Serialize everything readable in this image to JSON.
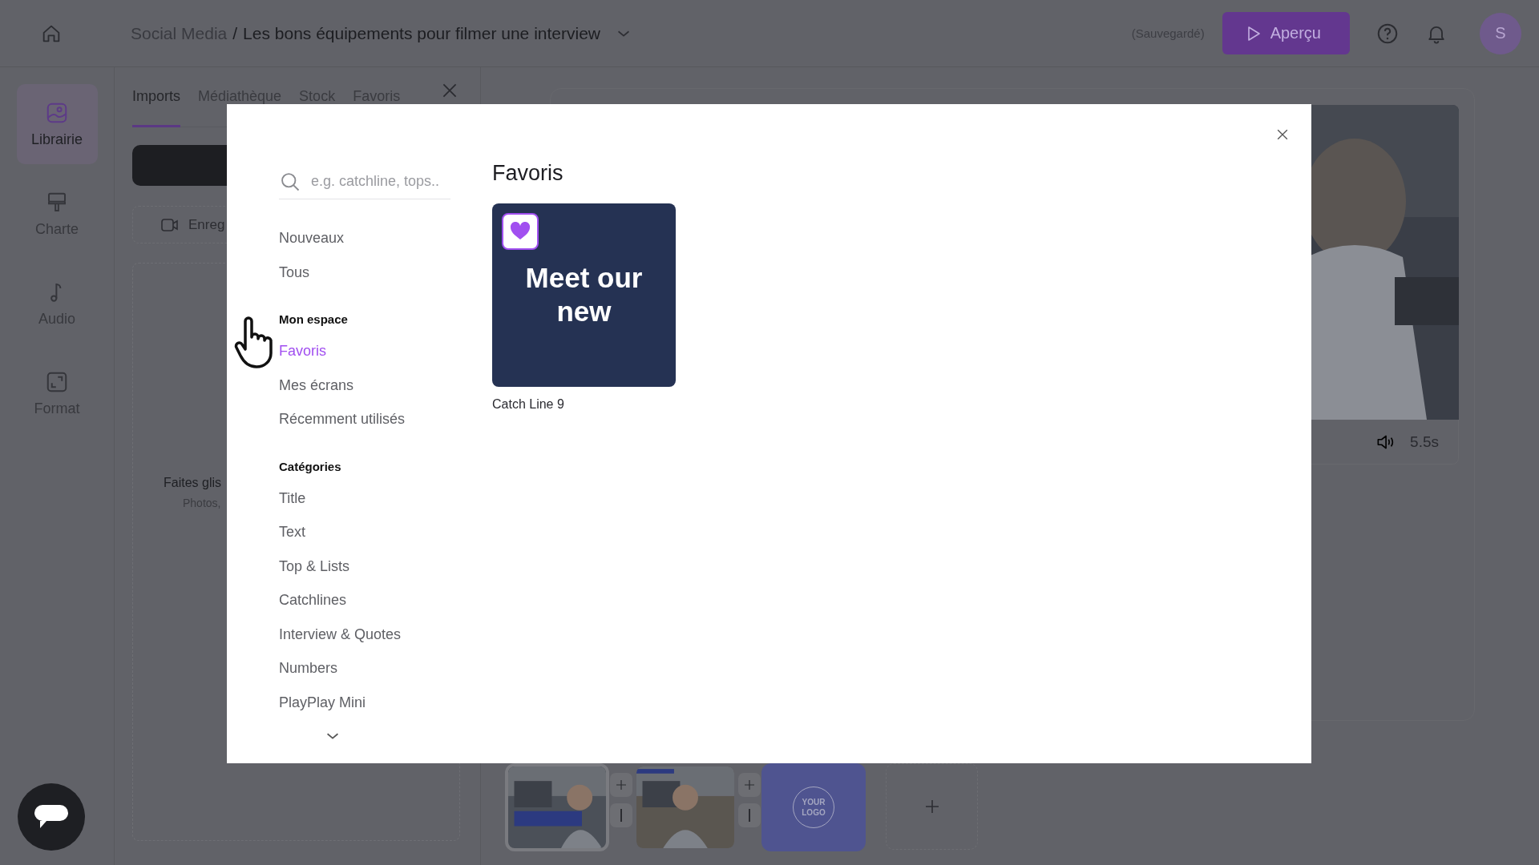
{
  "topbar": {
    "breadcrumb": "Social Media",
    "separator": "/",
    "title": "Les bons équipements pour filmer une interview",
    "save_status": "(Sauvegardé)",
    "preview_button": "Aperçu",
    "avatar": "S"
  },
  "rail": [
    {
      "label": "Librairie",
      "kind": "library",
      "selected": true
    },
    {
      "label": "Charte",
      "kind": "brand",
      "selected": false
    },
    {
      "label": "Audio",
      "kind": "audio",
      "selected": false
    },
    {
      "label": "Format",
      "kind": "format",
      "selected": false
    }
  ],
  "panel": {
    "tabs": [
      {
        "label": "Imports",
        "selected": true
      },
      {
        "label": "Médiathèque",
        "selected": false
      },
      {
        "label": "Stock",
        "selected": false
      },
      {
        "label": "Favoris",
        "selected": false
      }
    ],
    "record_button": "Enreg",
    "drop_title": "Faites glis",
    "drop_hint": "Photos,"
  },
  "preview": {
    "duration": "5.5s"
  },
  "timeline": {
    "slides": [
      {
        "kind": "picture",
        "selected": true
      },
      {
        "kind": "picture",
        "selected": false
      },
      {
        "kind": "logo",
        "text": "YOUR LOGO",
        "selected": false
      }
    ]
  },
  "modal": {
    "search": {
      "placeholder": "e.g. catchline, tops.."
    },
    "sections": [
      {
        "items": [
          {
            "label": "Nouveaux",
            "selected": false
          },
          {
            "label": "Tous",
            "selected": false
          }
        ]
      },
      {
        "heading": "Mon espace",
        "items": [
          {
            "label": "Favoris",
            "selected": true
          },
          {
            "label": "Mes écrans",
            "selected": false
          },
          {
            "label": "Récemment utilisés",
            "selected": false
          }
        ]
      },
      {
        "heading": "Catégories",
        "items": [
          {
            "label": "Title",
            "selected": false
          },
          {
            "label": "Text",
            "selected": false
          },
          {
            "label": "Top & Lists",
            "selected": false
          },
          {
            "label": "Catchlines",
            "selected": false
          },
          {
            "label": "Interview & Quotes",
            "selected": false
          },
          {
            "label": "Numbers",
            "selected": false
          },
          {
            "label": "PlayPlay Mini",
            "selected": false
          }
        ]
      }
    ],
    "title": "Favoris",
    "cards": [
      {
        "text": "Meet our new",
        "caption": "Catch Line 9",
        "favorite": true
      }
    ]
  }
}
